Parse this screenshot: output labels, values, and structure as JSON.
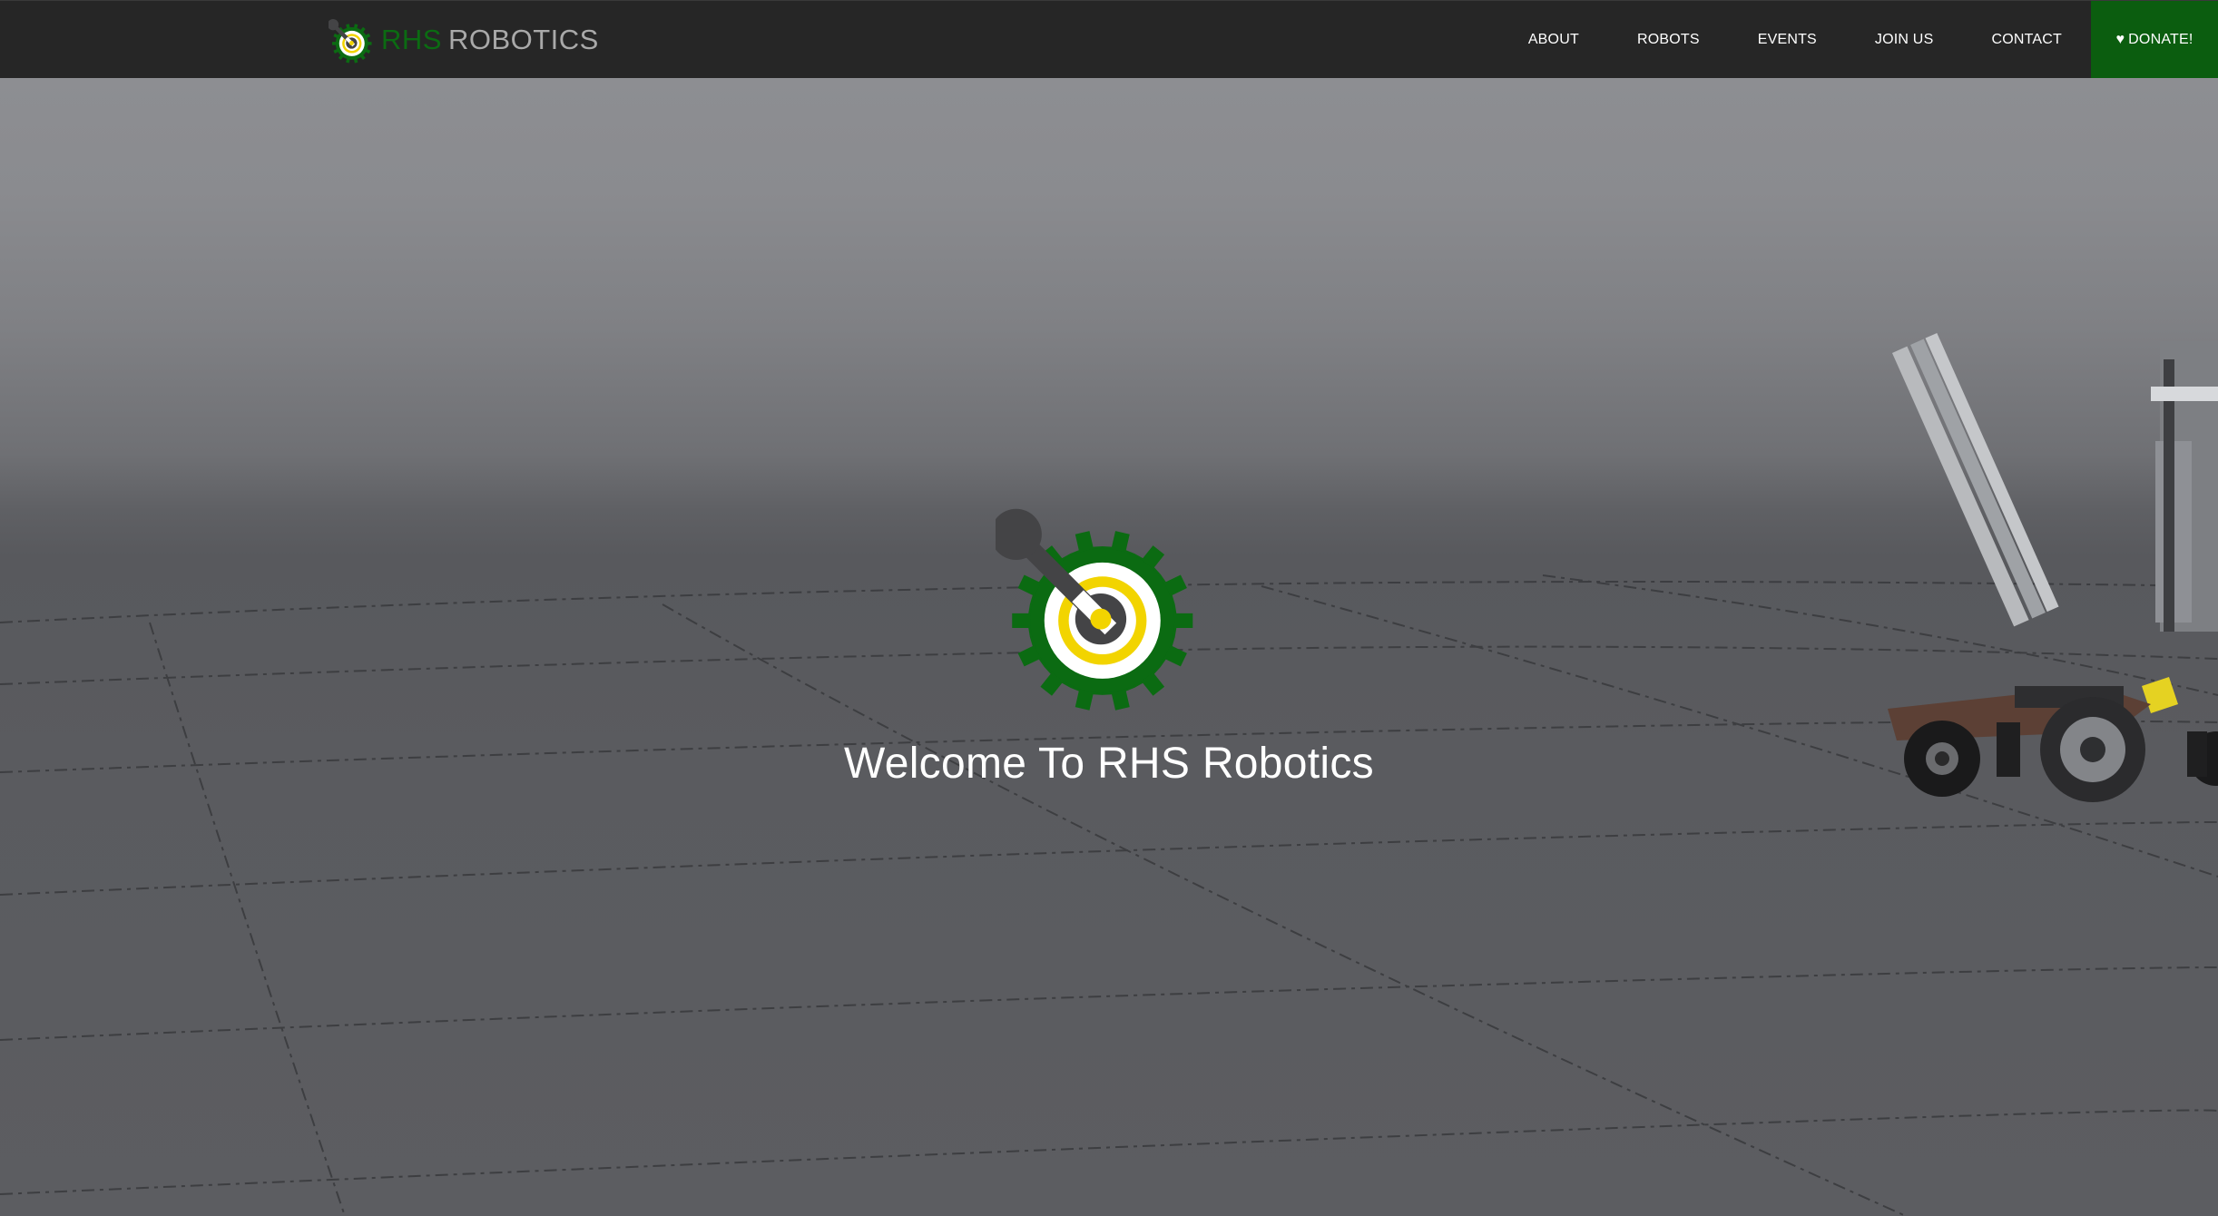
{
  "brand": {
    "name_part1": "RHS",
    "name_part2": "ROBOTICS",
    "logo_icon": "gear-wrench-logo",
    "colors": {
      "green": "#0b6b12",
      "yellow": "#f2d400",
      "grey": "#a9a9a9"
    }
  },
  "nav": {
    "items": [
      {
        "label": "ABOUT"
      },
      {
        "label": "ROBOTS"
      },
      {
        "label": "EVENTS"
      },
      {
        "label": "JOIN US"
      },
      {
        "label": "CONTACT"
      }
    ],
    "donate": {
      "icon": "heart-icon",
      "heart": "♥",
      "label": "DONATE!"
    }
  },
  "hero": {
    "title": "Welcome To RHS Robotics",
    "logo_icon": "gear-wrench-logo",
    "background": "robotics-field-render"
  },
  "colors": {
    "navbar_bg": "#262626",
    "donate_bg": "#0b5d0f",
    "hero_text": "#ffffff"
  }
}
